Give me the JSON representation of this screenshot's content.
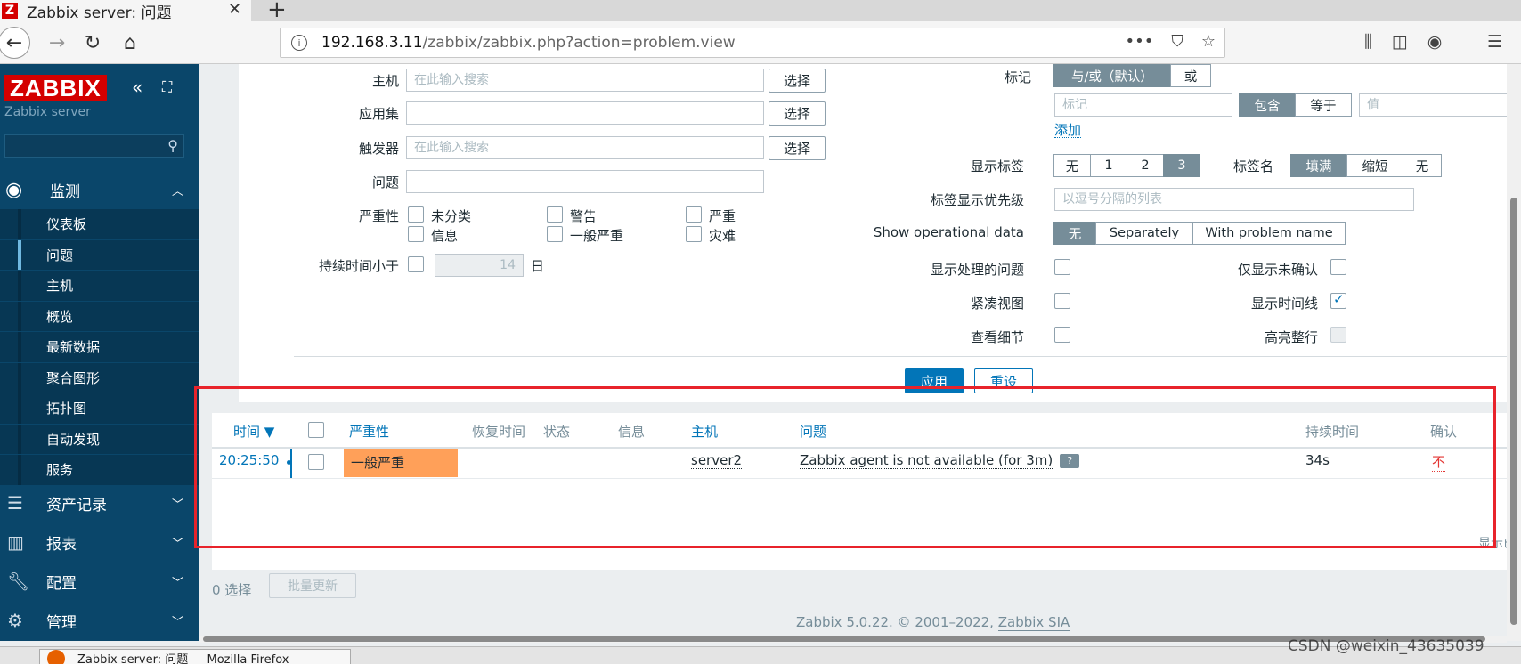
{
  "browser": {
    "tab_title": "Zabbix server: 问题",
    "tab_favicon": "Z",
    "url_host": "192.168.3.11",
    "url_path": "/zabbix/zabbix.php?action=problem.view",
    "taskbar_item": "Zabbix server: 问题 — Mozilla Firefox"
  },
  "sidebar": {
    "logo": "ZABBIX",
    "server_name": "Zabbix server",
    "monitor_label": "监测",
    "submenu": [
      "仪表板",
      "问题",
      "主机",
      "概览",
      "最新数据",
      "聚合图形",
      "拓扑图",
      "自动发现",
      "服务"
    ],
    "inventory_label": "资产记录",
    "reports_label": "报表",
    "config_label": "配置",
    "admin_label": "管理"
  },
  "filter": {
    "host_label": "主机",
    "host_placeholder": "在此输入搜索",
    "appset_label": "应用集",
    "trigger_label": "触发器",
    "trigger_placeholder": "在此输入搜索",
    "problem_label": "问题",
    "select_btn": "选择",
    "severity_label": "严重性",
    "severities": [
      "未分类",
      "警告",
      "严重",
      "信息",
      "一般严重",
      "灾难"
    ],
    "duration_label": "持续时间小于",
    "duration_value": "14",
    "duration_unit": "日",
    "tags_label": "标记",
    "tags_andor": "与/或（默认）",
    "tags_or": "或",
    "tag_placeholder": "标记",
    "tag_contains": "包含",
    "tag_equals": "等于",
    "tag_value_placeholder": "值",
    "tag_add": "添加",
    "show_tags_label": "显示标签",
    "show_tags_options": [
      "无",
      "1",
      "2",
      "3"
    ],
    "tag_name_label": "标签名",
    "tag_name_options": [
      "填满",
      "缩短",
      "无"
    ],
    "tag_priority_label": "标签显示优先级",
    "tag_priority_placeholder": "以逗号分隔的列表",
    "opdata_label": "Show operational data",
    "opdata_options": [
      "无",
      "Separately",
      "With problem name"
    ],
    "show_suppressed_label": "显示处理的问题",
    "unack_only_label": "仅显示未确认",
    "compact_label": "紧凑视图",
    "timeline_label": "显示时间线",
    "details_label": "查看细节",
    "highlight_label": "高亮整行",
    "apply_btn": "应用",
    "reset_btn": "重设"
  },
  "table": {
    "headers": {
      "time": "时间 ▼",
      "severity": "严重性",
      "recovery": "恢复时间",
      "status": "状态",
      "info": "信息",
      "host": "主机",
      "problem": "问题",
      "duration": "持续时间",
      "ack": "确认"
    },
    "rows": [
      {
        "time": "20:25:50",
        "severity": "一般严重",
        "host": "server2",
        "problem": "Zabbix agent is not available (for 3m)",
        "duration": "34s",
        "ack": "不"
      }
    ],
    "display_info": "显示已",
    "selected_count": "0 选择",
    "mass_update": "批量更新"
  },
  "footer": {
    "copyright_prefix": "Zabbix 5.0.22. © 2001–2022, ",
    "copyright_link": "Zabbix SIA"
  },
  "watermark": "CSDN @weixin_43635039",
  "colors": {
    "sidebar": "#0a466a",
    "accent": "#0275b8",
    "severity_average": "#ffa059",
    "highlight_box": "#e8232b"
  }
}
